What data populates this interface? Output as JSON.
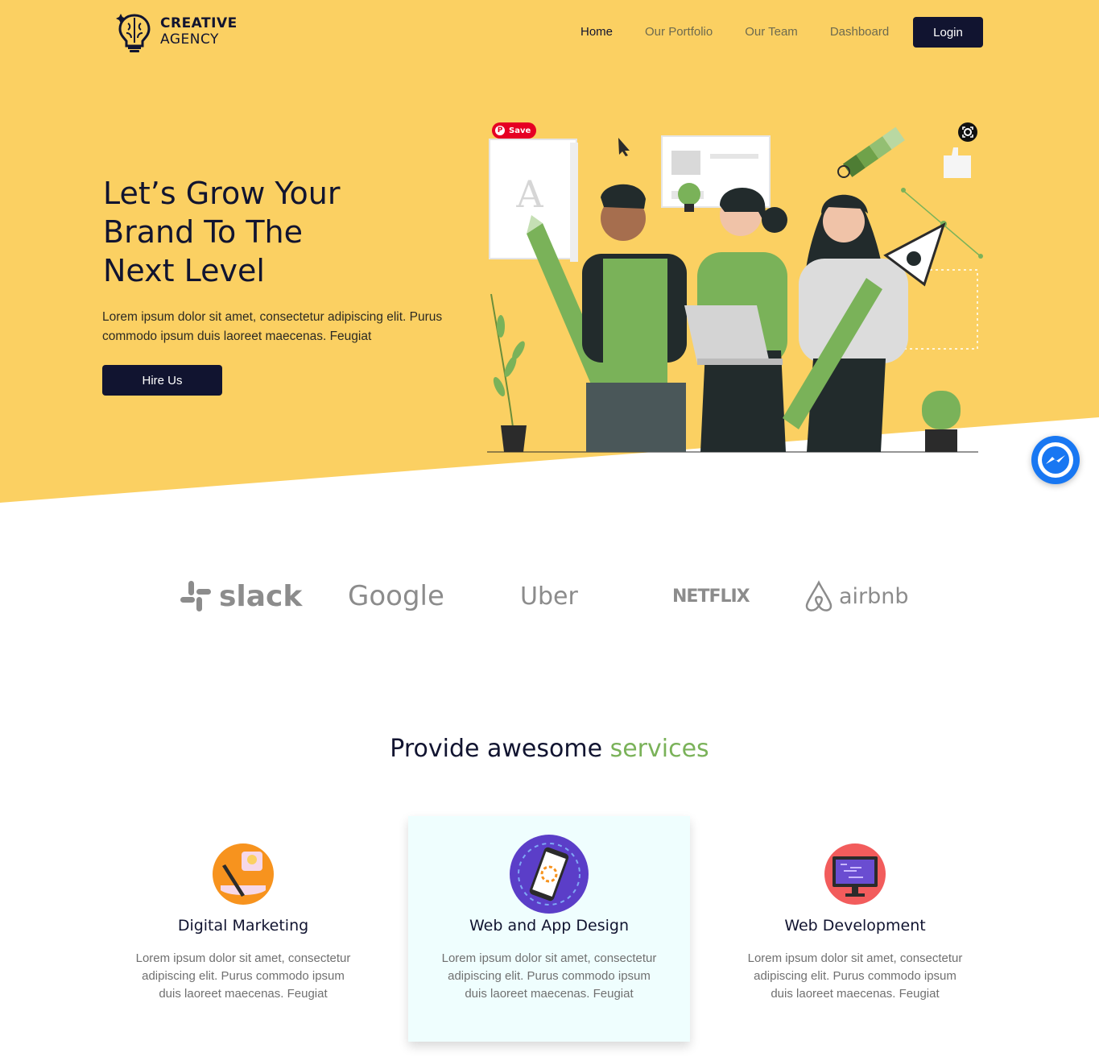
{
  "brand": {
    "line1": "CREATIVE",
    "line2": "AGENCY"
  },
  "nav": {
    "items": [
      {
        "label": "Home",
        "active": true
      },
      {
        "label": "Our Portfolio",
        "active": false
      },
      {
        "label": "Our Team",
        "active": false
      },
      {
        "label": "Dashboard",
        "active": false
      }
    ],
    "login_label": "Login"
  },
  "hero": {
    "title_lines": [
      "Let’s Grow Your",
      "Brand To The",
      "Next Level"
    ],
    "description": "Lorem ipsum dolor sit amet, consectetur adipiscing elit. Purus commodo ipsum duis laoreet maecenas. Feugiat",
    "cta_label": "Hire Us",
    "pin_save_label": "Save"
  },
  "clients": [
    "slack",
    "Google",
    "Uber",
    "NETFLIX",
    "airbnb"
  ],
  "services": {
    "title_prefix": "Provide awesome ",
    "title_accent": "services",
    "items": [
      {
        "name": "Digital Marketing",
        "description": "Lorem ipsum dolor sit amet, consectetur adipiscing elit. Purus commodo ipsum duis laoreet maecenas. Feugiat",
        "icon": "marketing-icon"
      },
      {
        "name": "Web and App Design",
        "description": "Lorem ipsum dolor sit amet, consectetur adipiscing elit. Purus commodo ipsum duis laoreet maecenas. Feugiat",
        "icon": "mobile-design-icon"
      },
      {
        "name": "Web Development",
        "description": "Lorem ipsum dolor sit amet, consectetur adipiscing elit. Purus commodo ipsum duis laoreet maecenas. Feugiat",
        "icon": "code-monitor-icon"
      }
    ]
  },
  "colors": {
    "hero_bg": "#fbd062",
    "dark": "#111430",
    "accent_green": "#7ab259",
    "featured_card": "#effefe",
    "messenger": "#1877f2"
  }
}
